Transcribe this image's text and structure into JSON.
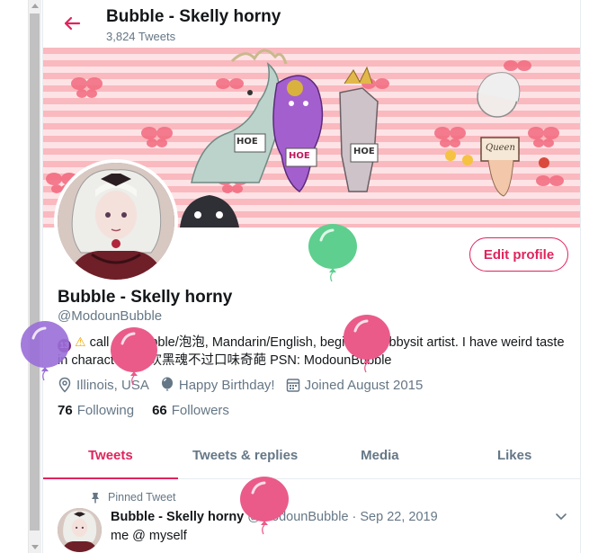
{
  "header": {
    "title": "Bubble - Skelly horny",
    "subtitle": "3,824 Tweets"
  },
  "banner": {
    "signs": [
      "HOE",
      "HOE",
      "HOE",
      "Queen"
    ]
  },
  "profile": {
    "edit_button": "Edit profile",
    "display_name": "Bubble - Skelly horny",
    "handle": "@ModounBubble",
    "bio_badge": "13",
    "bio_text": "call me Bubble/泡泡, Mandarin/English, beginner/hobbysit artist. I have weird taste in characters/喜欢黑魂不过口味奇葩 PSN: ModounBubble",
    "location": "Illinois, USA",
    "birthday": "Happy Birthday!",
    "joined": "Joined August 2015",
    "following_count": "76",
    "following_label": "Following",
    "followers_count": "66",
    "followers_label": "Followers"
  },
  "tabs": [
    {
      "label": "Tweets",
      "active": true
    },
    {
      "label": "Tweets & replies",
      "active": false
    },
    {
      "label": "Media",
      "active": false
    },
    {
      "label": "Likes",
      "active": false
    }
  ],
  "pinned_tweet": {
    "pinned_label": "Pinned Tweet",
    "name": "Bubble - Skelly horny",
    "handle": "@ModounBubble",
    "separator": "·",
    "date": "Sep 22, 2019",
    "text": "me @ myself"
  },
  "colors": {
    "accent": "#e0245e",
    "secondary_text": "#657786",
    "balloon_green": "#5ecf8e",
    "balloon_pink": "#ea5b8a",
    "balloon_purple": "#9a6ed8"
  },
  "icons": [
    "back-arrow-icon",
    "location-pin-icon",
    "balloon-icon",
    "calendar-icon",
    "pin-icon",
    "chevron-down-icon"
  ]
}
